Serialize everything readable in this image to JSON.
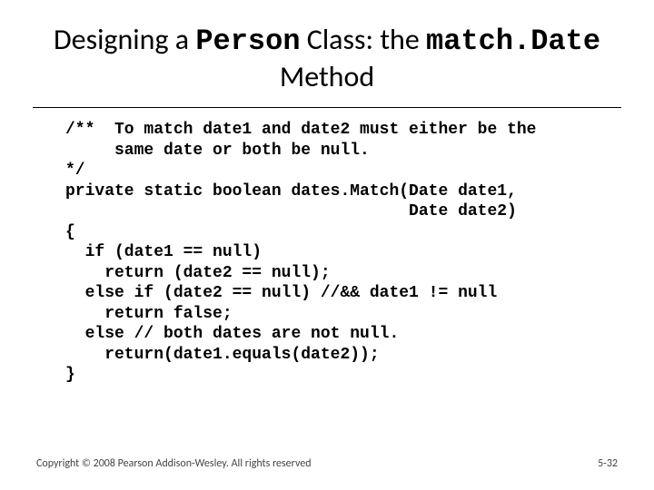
{
  "title": {
    "pre": "Designing a ",
    "mono1": "Person",
    "mid": " Class:  the ",
    "mono2": "match.Date",
    "line2": "Method"
  },
  "code": {
    "l01": "/**  To match date1 and date2 must either be the",
    "l02": "     same date or both be null.",
    "l03": "*/",
    "l04": "private static boolean dates.Match(Date date1,",
    "l05": "                                   Date date2)",
    "l06": "{",
    "l07": "  if (date1 == null)",
    "l08": "    return (date2 == null);",
    "l09": "  else if (date2 == null) //&& date1 != null",
    "l10": "    return false;",
    "l11": "  else // both dates are not null.",
    "l12": "    return(date1.equals(date2));",
    "l13": "}"
  },
  "footer": {
    "copyright": "Copyright © 2008 Pearson Addison-Wesley. All rights reserved",
    "pagenum": "5-32"
  }
}
